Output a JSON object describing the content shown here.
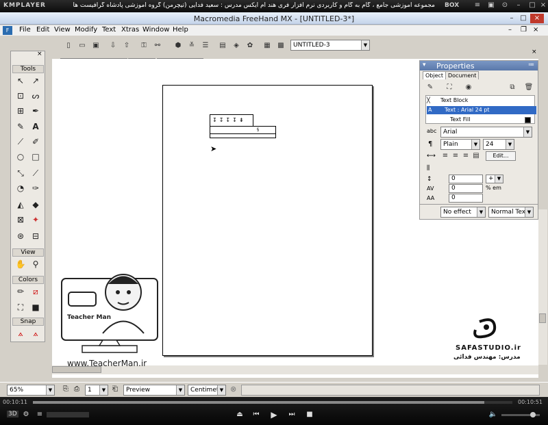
{
  "player": {
    "logo": "KMPLAYER",
    "title": "مجموعه آموزشی جامع ، گام به گام و کاربردی نرم افزار فری هند ام ایکس  مدرس : سعید فدایی (تیچرمن) گروه آموزشی پادشاه گرافیست ها",
    "box": "BOX",
    "time_current": "00:10:11",
    "time_total": "00:10:51",
    "badges": [
      "3D",
      "",
      "",
      "",
      "",
      ""
    ]
  },
  "window": {
    "title": "Macromedia FreeHand MX - [UNTITLED-3*]"
  },
  "menu": [
    "File",
    "Edit",
    "View",
    "Modify",
    "Text",
    "Xtras",
    "Window",
    "Help"
  ],
  "toolbar": {
    "doc_select": "UNTITLED-3"
  },
  "textbar": {
    "font": "Arial",
    "size": "24",
    "leading": "0"
  },
  "tools": {
    "title": "Tools",
    "view": "View",
    "colors": "Colors",
    "snap": "Snap"
  },
  "properties": {
    "title": "Properties",
    "tab_object": "Object",
    "tab_document": "Document",
    "items": [
      "Text Block",
      "Text : Arial 24 pt",
      "Text Fill"
    ],
    "font": "Arial",
    "style": "Plain",
    "size": "24",
    "edit": "Edit...",
    "v1": "0",
    "v2": "0",
    "v3": "0",
    "v4": "0",
    "unit": "% em",
    "effect": "No effect",
    "text_mode": "Normal Text"
  },
  "status": {
    "zoom": "65%",
    "page": "1",
    "view_mode": "Preview",
    "units": "Centimeters"
  },
  "overlay": {
    "site": "www.TeacherMan.ir",
    "logo_name": "Teacher Man",
    "safa": "SAFASTUDIO.ir",
    "teacher": "مدرس: مهندس فدائی"
  }
}
